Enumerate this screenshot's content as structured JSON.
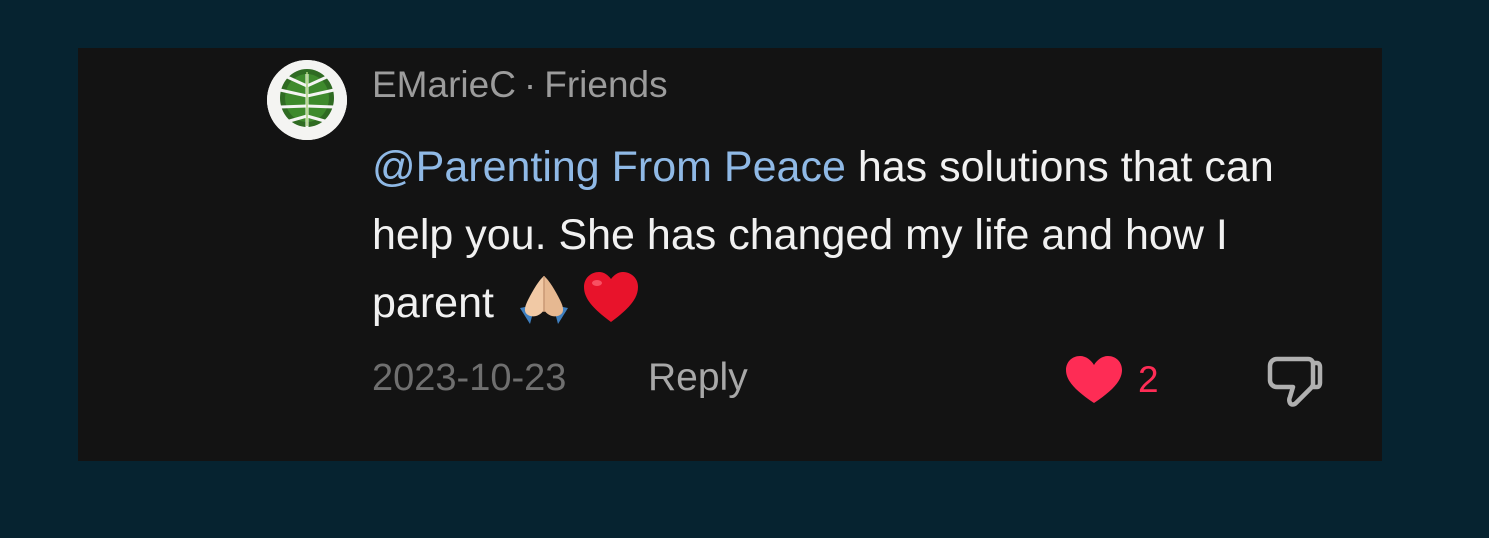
{
  "comment": {
    "username": "EMarieC",
    "separator": "·",
    "relation": "Friends",
    "avatar_icon": "monstera-leaf",
    "mention": "@Parenting From Peace",
    "text": " has solutions that can help you. She has changed my life and how I parent",
    "emojis": [
      "praying-hands",
      "red-heart"
    ],
    "date": "2023-10-23",
    "reply_label": "Reply",
    "like_count": "2",
    "like_icon": "heart-filled",
    "dislike_icon": "thumbs-down-outline",
    "colors": {
      "mention": "#8fb9e6",
      "like": "#fe2c55",
      "card_bg": "#131313",
      "page_bg": "#062330"
    }
  }
}
